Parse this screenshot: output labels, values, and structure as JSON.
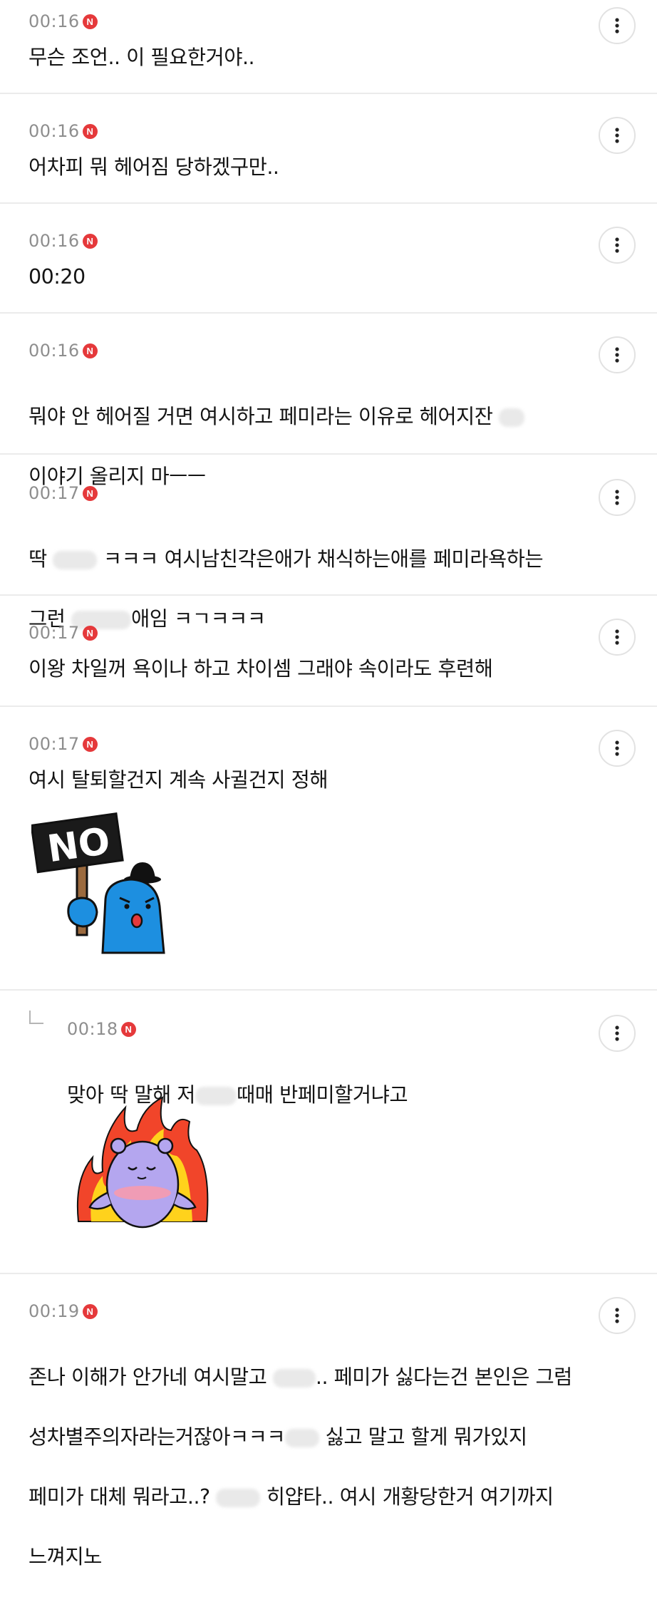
{
  "badge_label": "N",
  "comments": [
    {
      "time": "00:16",
      "text": "무슨 조언.. 이 필요한거야.."
    },
    {
      "time": "00:16",
      "text": "어차피 뭐 헤어짐 당하겠구만.."
    },
    {
      "time": "00:16",
      "text": "00:20"
    },
    {
      "time": "00:16",
      "line1": "뭐야 안 헤어질 거면 여시하고 페미라는 이유로 헤어지잔",
      "line2": "이야기 올리지 마ㅡㅡ"
    },
    {
      "time": "00:17",
      "l1a": "딱",
      "l1b": "ㅋㅋㅋ 여시남친각은애가 채식하는애를 페미라욕하는",
      "l2a": "그런",
      "l2b": "애임 ㅋㄱㅋㅋㅋ"
    },
    {
      "time": "00:17",
      "text": "이왕 차일꺼 욕이나 하고 차이셈 그래야 속이라도 후련해"
    },
    {
      "time": "00:17",
      "text": "여시 탈퇴할건지 계속 사귈건지 정해",
      "sticker": "NO",
      "sticker_icon": "blue-character-holding-no-sign-sticker"
    },
    {
      "time": "00:18",
      "a": "맞아 딱 말해 저",
      "b": "때매 반페미할거냐고",
      "sticker_icon": "purple-character-flames-sticker"
    },
    {
      "time": "00:19",
      "l1a": "존나 이해가 안가네 여시말고",
      "l1b": ".. 페미가 싫다는건 본인은 그럼",
      "l2a": "성차별주의자라는거잖아ㅋㅋㅋ",
      "l2b": "싫고 말고 할게 뭐가있지",
      "l3a": "페미가 대체 뭐라고..?",
      "l3b": "히얍타.. 여시 개황당한거 여기까지",
      "l4": "느껴지노"
    }
  ],
  "colors": {
    "accent": "#e5393b",
    "time": "#8e8e8e",
    "divider": "#ebebeb",
    "sticker_blue": "#1d8fe0",
    "sticker_purple": "#b4a6ef",
    "flame_red": "#f1452a",
    "flame_yellow": "#ffd21c"
  }
}
